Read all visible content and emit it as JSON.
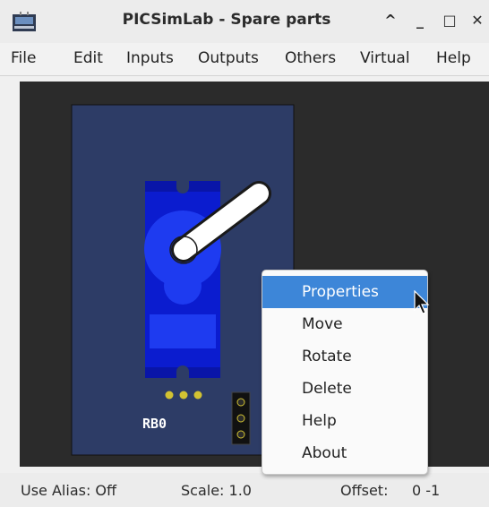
{
  "window": {
    "title": "PICSimLab - Spare parts",
    "controls": [
      "^",
      "_",
      "□",
      "✕"
    ]
  },
  "menu": [
    "File",
    "Edit",
    "Inputs",
    "Outputs",
    "Others",
    "Virtual",
    "Help"
  ],
  "part": {
    "pin_label": "RB0"
  },
  "context_menu": {
    "items": [
      "Properties",
      "Move",
      "Rotate",
      "Delete",
      "Help",
      "About"
    ],
    "highlighted": "Properties"
  },
  "status": {
    "alias": "Use Alias: Off",
    "scale": "Scale: 1.0",
    "offset_label": "Offset:",
    "offset_value": "0 -1"
  },
  "colors": {
    "board": "#2d3c66",
    "servo_body": "#0b1ccf",
    "servo_horn_base": "#1e3bf0",
    "canvas_bg": "#2b2b2b",
    "highlight": "#3d86d8"
  }
}
